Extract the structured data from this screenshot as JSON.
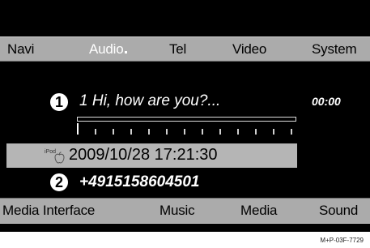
{
  "top_menu": {
    "items": [
      {
        "label": "Navi"
      },
      {
        "label": "Audio"
      },
      {
        "label": "Tel"
      },
      {
        "label": "Video"
      },
      {
        "label": "System"
      }
    ],
    "active": "Audio"
  },
  "player": {
    "marker_1": "1",
    "track_title": "1 Hi, how are you?...",
    "time": "00:00",
    "source_label": "iPod",
    "date_time": "2009/10/28 17:21:30",
    "marker_2": "2",
    "phone_number": "+4915158604501"
  },
  "bottom_menu": {
    "items": [
      {
        "label": "Media Interface"
      },
      {
        "label": "Music"
      },
      {
        "label": "Media"
      },
      {
        "label": "Sound"
      }
    ]
  },
  "caption": "M+P-03F-7729",
  "colors": {
    "screen": "#000000",
    "menu_bar": "#ababab",
    "active_tab": "#ffffff",
    "info_box": "#b5b5b5"
  },
  "icons": {
    "source_icon": "apple-icon"
  }
}
